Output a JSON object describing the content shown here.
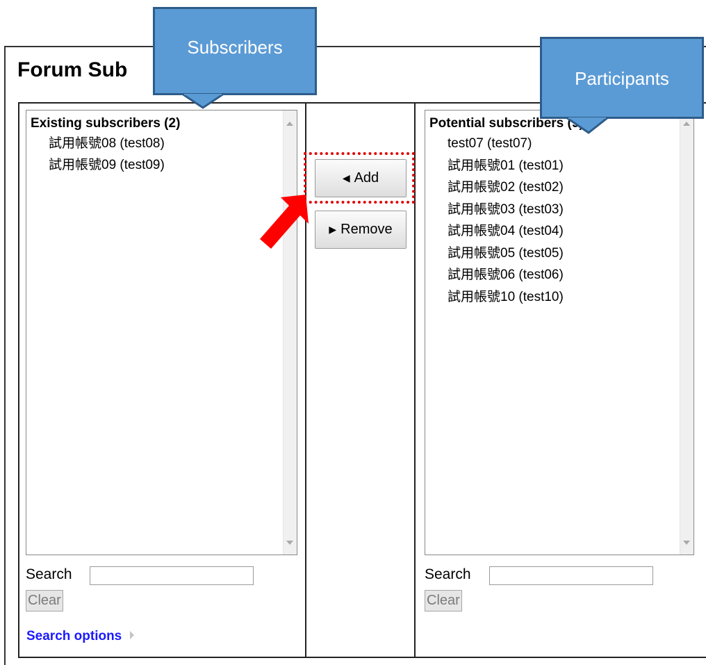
{
  "page": {
    "title": "Forum Sub"
  },
  "left": {
    "group_label": "Existing subscribers (2)",
    "options": [
      "試用帳號08 (test08)",
      "試用帳號09 (test09)"
    ],
    "search_label": "Search",
    "search_value": "",
    "clear_label": "Clear",
    "search_options_label": "Search options"
  },
  "right": {
    "group_label": "Potential subscribers (9)",
    "options": [
      "test07 (test07)",
      "試用帳號01 (test01)",
      "試用帳號02 (test02)",
      "試用帳號03 (test03)",
      "試用帳號04 (test04)",
      "試用帳號05 (test05)",
      "試用帳號06 (test06)",
      "試用帳號10 (test10)"
    ],
    "search_label": "Search",
    "search_value": "",
    "clear_label": "Clear"
  },
  "buttons": {
    "add_label": "Add",
    "add_glyph": "◀",
    "remove_label": "Remove",
    "remove_glyph": "▶"
  },
  "annotations": {
    "subscribers_callout": "Subscribers",
    "participants_callout": "Participants",
    "callout_color": "#5b9bd5",
    "highlight_color": "#e00000",
    "arrow_color": "#ff0000"
  }
}
